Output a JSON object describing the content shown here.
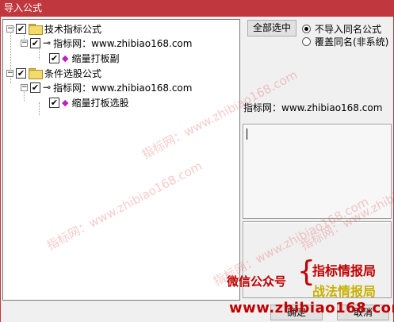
{
  "window": {
    "title": "导入公式"
  },
  "tree": {
    "root1": {
      "label": "技术指标公式"
    },
    "group1": {
      "label": "指标网：www.zhibiao168.com"
    },
    "item1": {
      "label": "缩量打板副"
    },
    "root2": {
      "label": "条件选股公式"
    },
    "group2": {
      "label": "指标网：www.zhibiao168.com"
    },
    "item2": {
      "label": "缩量打板选股"
    }
  },
  "buttons": {
    "select_all": "全部选中",
    "ok": "确定",
    "cancel": "取消"
  },
  "options": {
    "no_import": "不导入同名公式",
    "overwrite": "覆盖同名(非系统)",
    "selected": "no_import"
  },
  "info": {
    "label": "指标网：www.zhibiao168.com"
  },
  "watermark": {
    "text": "指标网：www.zhibiao168.com"
  },
  "promo": {
    "wechat": "微信公众号",
    "line1": "指标情报局",
    "line2": "战法情报局",
    "url": "www.zhibiao168.com"
  },
  "colors": {
    "title_bar": "#c0383d",
    "promo_red": "#c00000",
    "promo_gold": "#c8b000"
  }
}
